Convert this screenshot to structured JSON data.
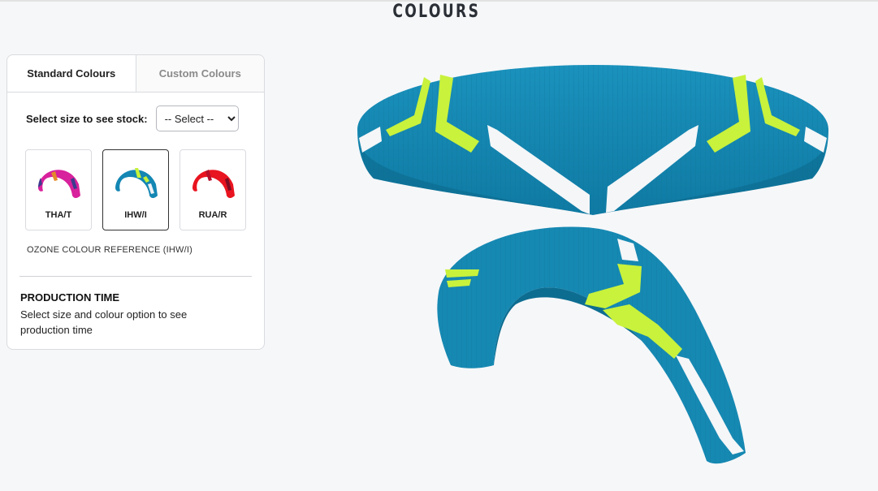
{
  "page": {
    "title": "COLOURS"
  },
  "tabs": [
    {
      "label": "Standard Colours",
      "active": true
    },
    {
      "label": "Custom Colours",
      "active": false
    }
  ],
  "size_selector": {
    "label": "Select size to see stock:",
    "selected": "-- Select --",
    "options": [
      "-- Select --"
    ]
  },
  "swatches": [
    {
      "code": "THA/T",
      "selected": false,
      "colors": {
        "main": "#d8219c",
        "accent": "#e48a2a",
        "tip": "#3d3a8e"
      }
    },
    {
      "code": "IHW/I",
      "selected": true,
      "colors": {
        "main": "#1487b3",
        "accent": "#c6f23a",
        "tip": "#0f6f99"
      }
    },
    {
      "code": "RUA/R",
      "selected": false,
      "colors": {
        "main": "#e8141f",
        "accent": "#b70f2a",
        "tip": "#7d0c22"
      }
    }
  ],
  "colour_reference": "OZONE COLOUR REFERENCE (IHW/I)",
  "production": {
    "heading": "PRODUCTION TIME",
    "description": "Select size and colour option to see production time"
  },
  "wing_colors": {
    "main": "#1689b3",
    "dark": "#0e6e93",
    "accent": "#c8f23c",
    "white": "#f4f6f8"
  }
}
